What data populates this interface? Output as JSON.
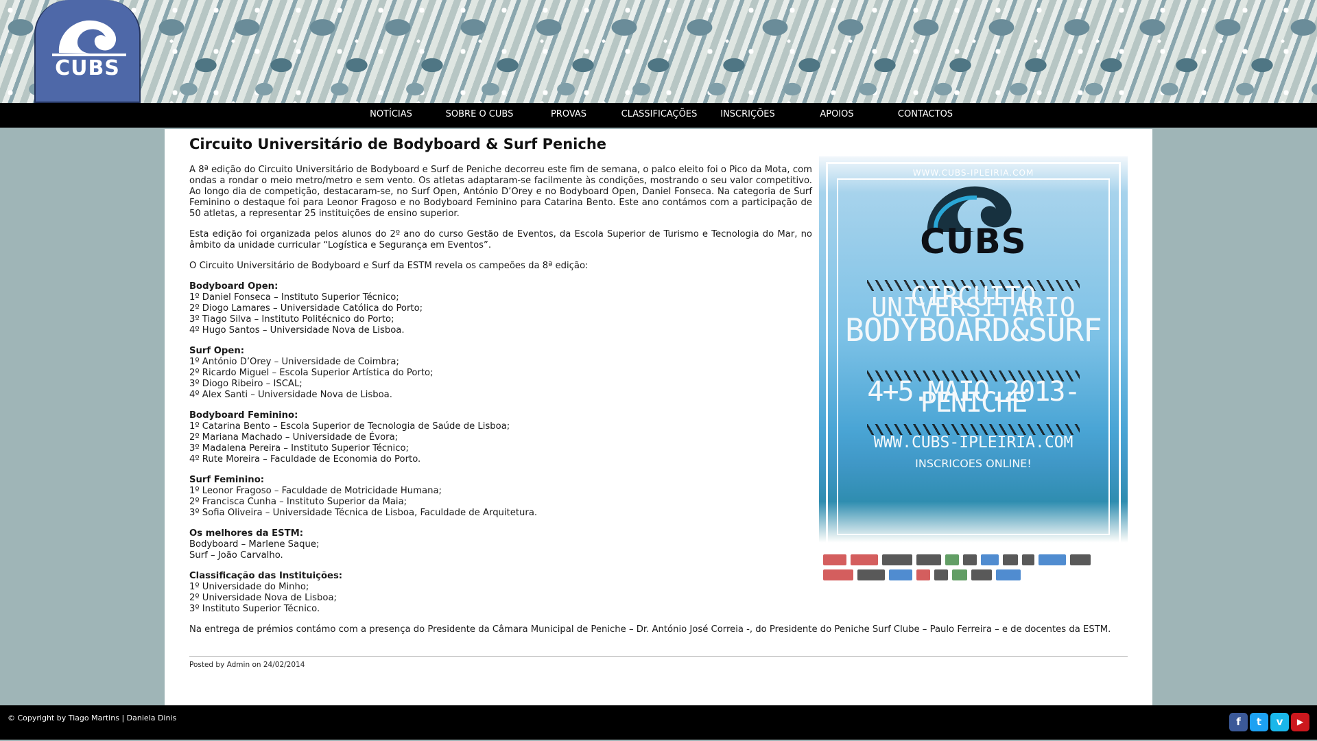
{
  "logo": {
    "text": "CUBS"
  },
  "nav": [
    {
      "label": "NOTÍCIAS"
    },
    {
      "label": "SOBRE O CUBS"
    },
    {
      "label": "PROVAS"
    },
    {
      "label": "CLASSIFICAÇÕES"
    },
    {
      "label": "INSCRIÇÕES"
    },
    {
      "label": "APOIOS"
    },
    {
      "label": "CONTACTOS"
    }
  ],
  "post": {
    "title": "Circuito Universitário de Bodyboard & Surf Peniche",
    "intro_paragraphs": [
      "A 8ª edição do Circuito Universitário de Bodyboard e Surf de Peniche decorreu este fim de semana, o palco eleito foi o Pico da Mota, com ondas a rondar o meio metro/metro e sem vento. Os atletas adaptaram-se facilmente às condições, mostrando o seu valor competitivo. Ao longo dia de competição, destacaram-se, no Surf Open, António D’Orey e no Bodyboard Open, Daniel Fonseca. Na categoria de Surf Feminino o destaque foi para Leonor Fragoso e no Bodyboard Feminino para Catarina Bento. Este ano contámos com a participação de 50 atletas, a representar 25 instituições de ensino superior.",
      "Esta edição foi organizada pelos alunos do 2º ano do curso Gestão de Eventos, da Escola Superior de Turismo e Tecnologia do Mar, no âmbito da unidade curricular “Logística e Segurança em Eventos”.",
      "O Circuito Universitário de Bodyboard e Surf da ESTM revela os campeões da 8ª edição:"
    ],
    "sections": [
      {
        "heading": "Bodyboard Open:",
        "lines": [
          "1º Daniel Fonseca – Instituto Superior Técnico;",
          "2º Diogo Lamares – Universidade Católica do Porto;",
          "3º Tiago Silva – Instituto Politécnico do Porto;",
          "4º Hugo Santos – Universidade Nova de Lisboa."
        ]
      },
      {
        "heading": "Surf Open:",
        "lines": [
          "1º António D’Orey – Universidade de Coimbra;",
          "2º Ricardo Miguel – Escola Superior Artística do Porto;",
          "3º Diogo Ribeiro – ISCAL;",
          "4º Alex Santi – Universidade Nova de Lisboa."
        ]
      },
      {
        "heading": "Bodyboard Feminino:",
        "lines": [
          "1º Catarina Bento – Escola Superior de Tecnologia de Saúde de Lisboa;",
          "2º Mariana Machado – Universidade de Évora;",
          "3º Madalena Pereira – Instituto Superior Técnico;",
          "4º Rute Moreira – Faculdade de Economia do Porto."
        ]
      },
      {
        "heading": "Surf Feminino:",
        "lines": [
          "1º Leonor Fragoso – Faculdade de Motricidade Humana;",
          "2º Francisca Cunha – Instituto Superior da Maia;",
          "3º Sofia Oliveira – Universidade Técnica de Lisboa, Faculdade de Arquitetura."
        ]
      },
      {
        "heading": "Os melhores da ESTM:",
        "lines": [
          "Bodyboard – Marlene Saque;",
          "Surf – João Carvalho."
        ]
      },
      {
        "heading": "Classificação das Instituições:",
        "lines": [
          "1º Universidade do Minho;",
          "2º Universidade Nova de Lisboa;",
          "3º Instituto Superior Técnico."
        ]
      }
    ],
    "closing": "Na entrega de prémios contámo com a presença do Presidente da Câmara Municipal de Peniche – Dr. António José Correia -, do Presidente do Peniche Surf Clube – Paulo Ferreira – e de docentes da ESTM.",
    "meta": "Posted by Admin on 24/02/2014"
  },
  "poster": {
    "url_top": "WWW.CUBS-IPLEIRIA.COM",
    "logo_text": "CUBS",
    "line1": "CIRCUITO UNIVERSITARIO",
    "line2": "BODYBOARD&SURF",
    "date": "4+5.MAIO.2013-PENICHE",
    "url": "WWW.CUBS-IPLEIRIA.COM",
    "signup": "INSCRICOES ONLINE!"
  },
  "footer": {
    "copyright": "© Copyright by Tiago Martins | Daniela Dinis",
    "social": [
      {
        "name": "facebook",
        "glyph": "f",
        "color": "#3b5998"
      },
      {
        "name": "twitter",
        "glyph": "t",
        "color": "#1da1f2"
      },
      {
        "name": "vimeo",
        "glyph": "v",
        "color": "#1ab7ea"
      },
      {
        "name": "youtube",
        "glyph": "▶",
        "color": "#cc181e"
      }
    ]
  }
}
